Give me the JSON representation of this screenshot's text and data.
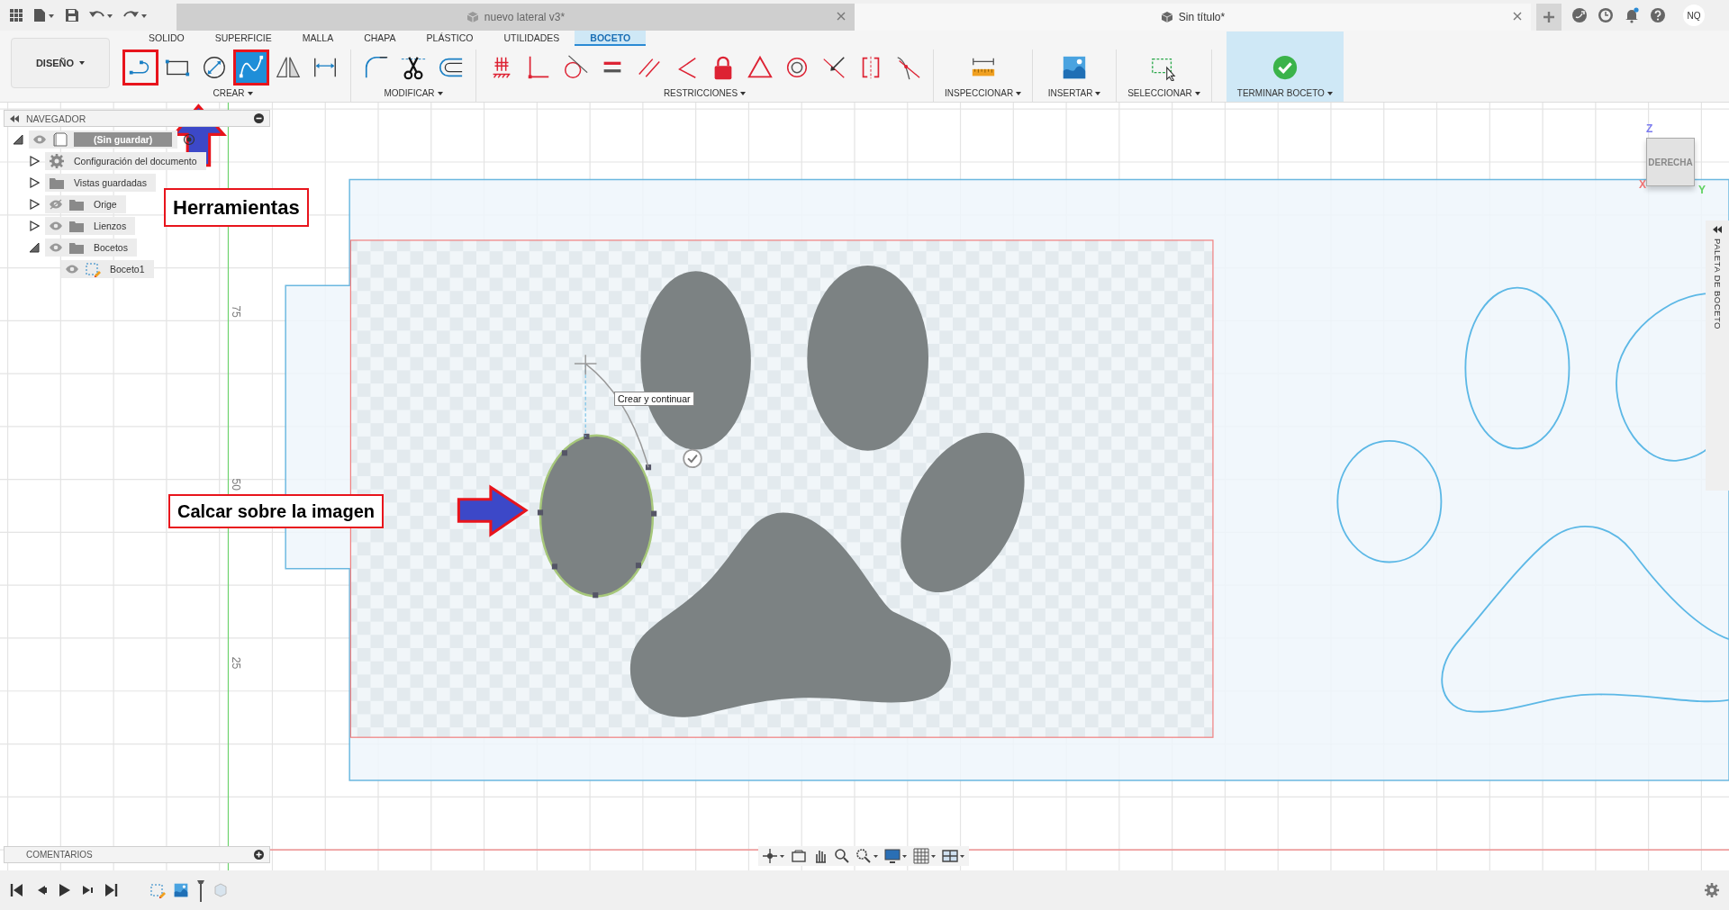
{
  "top_bar": {
    "documents": [
      {
        "title": "nuevo lateral v3*",
        "selected": false
      },
      {
        "title": "Sin título*",
        "selected": true
      }
    ],
    "user_initials": "NQ"
  },
  "toolbar": {
    "workspace": "DISEÑO",
    "tabs": [
      {
        "label": "SOLIDO",
        "selected": false
      },
      {
        "label": "SUPERFICIE",
        "selected": false
      },
      {
        "label": "MALLA",
        "selected": false
      },
      {
        "label": "CHAPA",
        "selected": false
      },
      {
        "label": "PLÁSTICO",
        "selected": false
      },
      {
        "label": "UTILIDADES",
        "selected": false
      },
      {
        "label": "BOCETO",
        "selected": true
      }
    ],
    "groups": [
      {
        "label": "CREAR",
        "primary": false,
        "tools": [
          {
            "kind": "line",
            "selected": false,
            "highlighted": true
          },
          {
            "kind": "rectangle",
            "selected": false,
            "highlighted": false
          },
          {
            "kind": "circle",
            "selected": false,
            "highlighted": false
          },
          {
            "kind": "spline",
            "selected": true,
            "highlighted": true
          },
          {
            "kind": "mirror",
            "selected": false,
            "highlighted": false
          },
          {
            "kind": "dimension",
            "selected": false,
            "highlighted": false
          }
        ]
      },
      {
        "label": "MODIFICAR",
        "primary": false,
        "tools": [
          {
            "kind": "fillet",
            "selected": false,
            "highlighted": false
          },
          {
            "kind": "scissors",
            "selected": false,
            "highlighted": false
          },
          {
            "kind": "offset",
            "selected": false,
            "highlighted": false
          }
        ]
      },
      {
        "label": "RESTRICCIONES",
        "primary": false,
        "tools": [
          {
            "kind": "fix",
            "selected": false,
            "highlighted": false
          },
          {
            "kind": "perpendicular",
            "selected": false,
            "highlighted": false
          },
          {
            "kind": "tangent",
            "selected": false,
            "highlighted": false
          },
          {
            "kind": "equal",
            "selected": false,
            "highlighted": false
          },
          {
            "kind": "parallel",
            "selected": false,
            "highlighted": false
          },
          {
            "kind": "angle",
            "selected": false,
            "highlighted": false
          },
          {
            "kind": "lock",
            "selected": false,
            "highlighted": false
          },
          {
            "kind": "triangle",
            "selected": false,
            "highlighted": false
          },
          {
            "kind": "concentric",
            "selected": false,
            "highlighted": false
          },
          {
            "kind": "midpoint",
            "selected": false,
            "highlighted": false
          },
          {
            "kind": "symmetry",
            "selected": false,
            "highlighted": false
          },
          {
            "kind": "curvature",
            "selected": false,
            "highlighted": false
          }
        ]
      },
      {
        "label": "INSPECCIONAR",
        "primary": false,
        "tools": [
          {
            "kind": "ruler",
            "selected": false,
            "highlighted": false
          }
        ]
      },
      {
        "label": "INSERTAR",
        "primary": false,
        "tools": [
          {
            "kind": "image",
            "selected": false,
            "highlighted": false
          }
        ]
      },
      {
        "label": "SELECCIONAR",
        "primary": false,
        "tools": [
          {
            "kind": "select",
            "selected": false,
            "highlighted": false
          }
        ]
      },
      {
        "label": "TERMINAR BOCETO",
        "primary": true,
        "tools": [
          {
            "kind": "finish",
            "selected": false,
            "highlighted": false
          }
        ]
      }
    ]
  },
  "navigator": {
    "title": "NAVEGADOR",
    "tree": [
      {
        "label": "(Sin guardar)",
        "kind": "component",
        "visible": true,
        "expanded": true,
        "selected": true,
        "children": [
          {
            "label": "Configuración del documento",
            "kind": "settings",
            "expanded": false,
            "selected": false
          },
          {
            "label": "Vistas guardadas",
            "kind": "folder",
            "expanded": false,
            "selected": false
          },
          {
            "label": "Orige",
            "kind": "folder",
            "visible": false,
            "expanded": false,
            "selected": false
          },
          {
            "label": "Lienzos",
            "kind": "folder",
            "visible": true,
            "expanded": false,
            "selected": false
          },
          {
            "label": "Bocetos",
            "kind": "folder",
            "visible": true,
            "expanded": true,
            "selected": false,
            "children": [
              {
                "label": "Boceto1",
                "kind": "sketch",
                "visible": true,
                "selected": false
              }
            ]
          }
        ]
      }
    ]
  },
  "canvas": {
    "ruler_labels": [
      "75",
      "50",
      "25"
    ],
    "tooltip": "Crear y continuar",
    "view_cube": {
      "face": "DERECHA",
      "axis_z": "Z",
      "axis_x": "X",
      "axis_y": "Y"
    },
    "side_palette": "PALETA DE BOCETO"
  },
  "annotations": [
    {
      "kind": "label",
      "text": "Herramientas"
    },
    {
      "kind": "label",
      "text": "Calcar sobre la imagen"
    },
    {
      "kind": "arrow-up"
    },
    {
      "kind": "arrow-right"
    }
  ],
  "comments": {
    "title": "COMENTARIOS"
  }
}
